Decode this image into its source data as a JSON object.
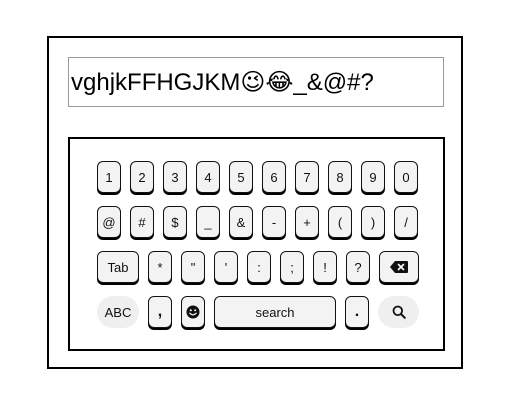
{
  "input": {
    "value": "vghjkFFHGJKM😉😂_&@#?"
  },
  "keyboard": {
    "row1": [
      "1",
      "2",
      "3",
      "4",
      "5",
      "6",
      "7",
      "8",
      "9",
      "0"
    ],
    "row2": [
      "@",
      "#",
      "$",
      "_",
      "&",
      "-",
      "+",
      "(",
      ")",
      "/"
    ],
    "row3": {
      "tab": "Tab",
      "keys": [
        "*",
        "\"",
        "'",
        ":",
        ";",
        "!",
        "?"
      ],
      "backspace_icon": "backspace-icon"
    },
    "row4": {
      "abc": "ABC",
      "comma": ",",
      "emoji_icon": "emoji-icon",
      "search": "search",
      "period": ".",
      "search_icon": "search-icon"
    }
  }
}
